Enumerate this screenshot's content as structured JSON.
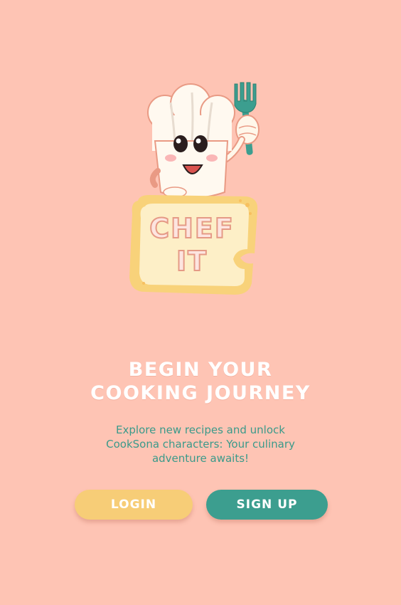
{
  "logo": {
    "text_line1": "CHEF",
    "text_line2": "IT"
  },
  "headline": {
    "line1": "BEGIN YOUR",
    "line2": "COOKING JOURNEY"
  },
  "subtitle": "Explore new recipes and unlock CookSona characters: Your culinary adventure awaits!",
  "buttons": {
    "login": "LOGIN",
    "signup": "SIGN UP"
  },
  "colors": {
    "background": "#FEC4B4",
    "login_button": "#F7CD77",
    "signup_button": "#3C9E8F",
    "subtitle_text": "#3A9A8A",
    "headline_text": "#FFFFFF"
  }
}
